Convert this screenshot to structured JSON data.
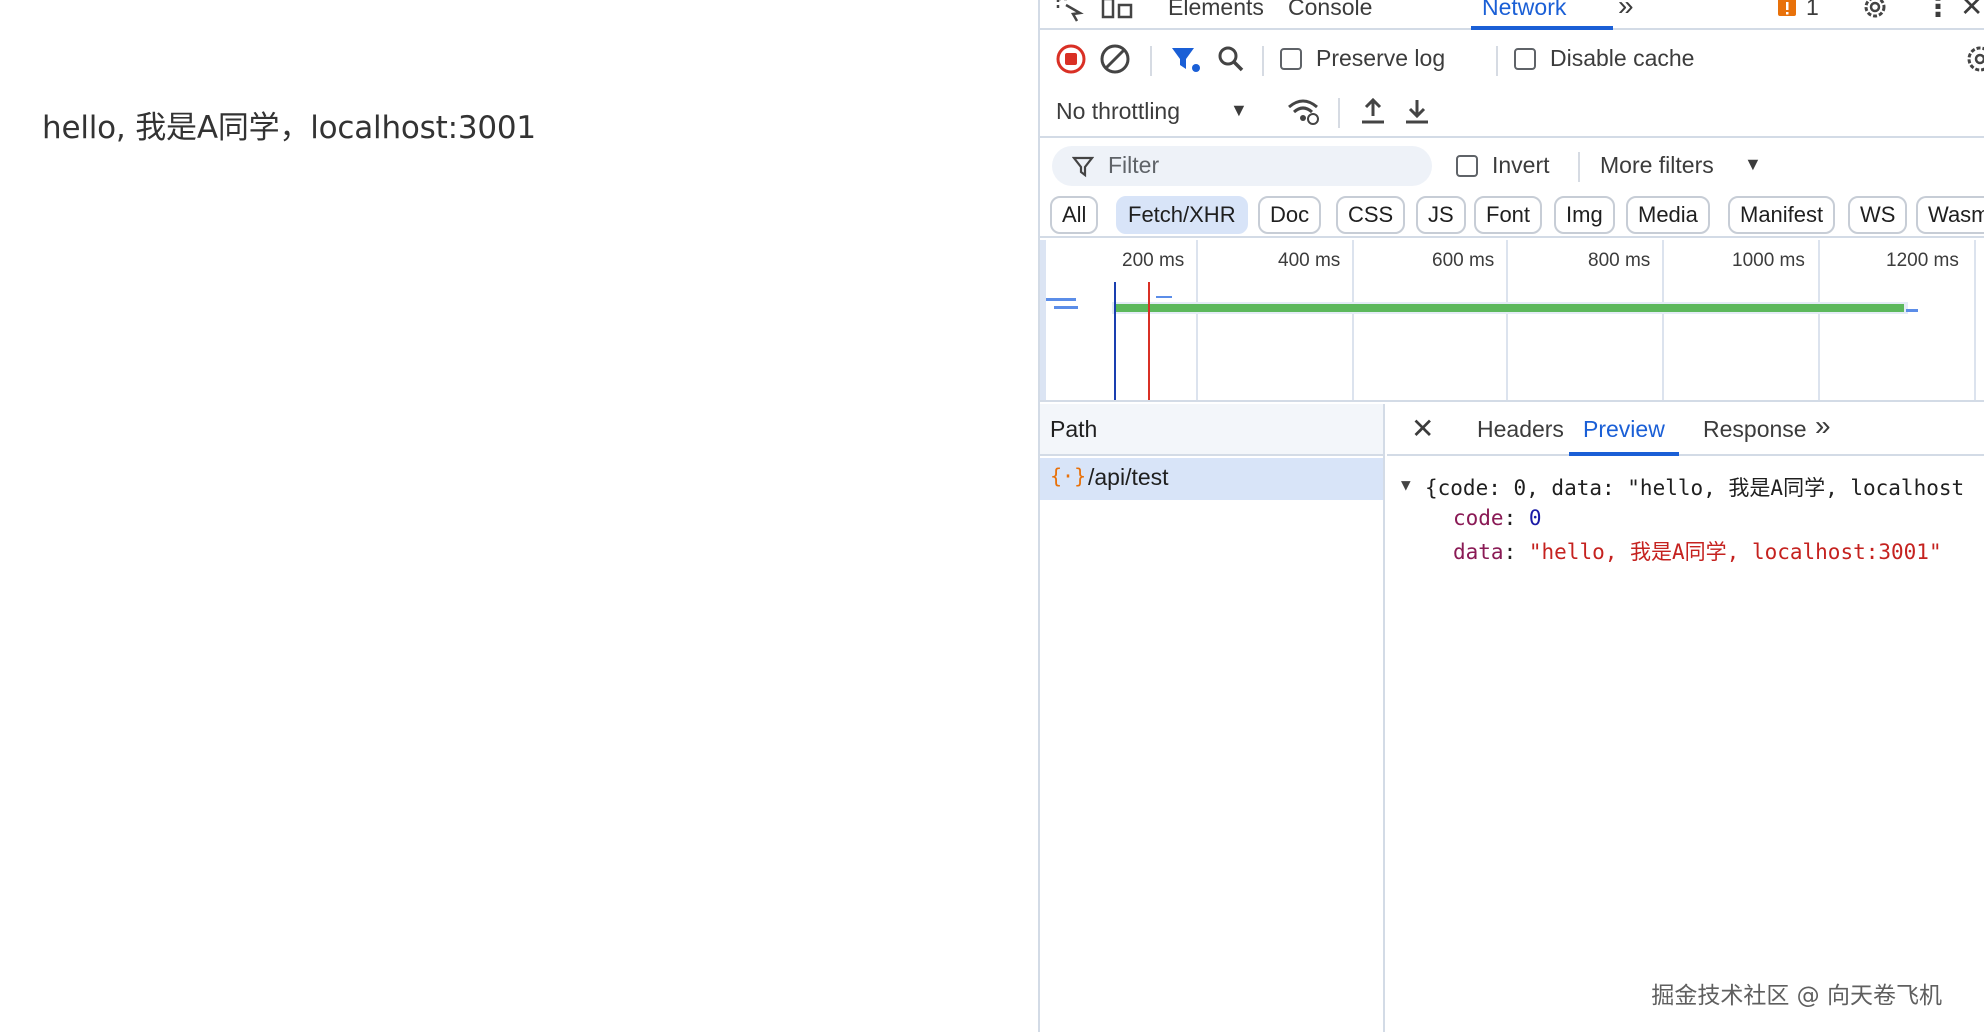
{
  "page": {
    "text": "hello, 我是A同学，localhost:3001"
  },
  "devtools": {
    "main_tabs": [
      "Elements",
      "Console",
      "Network"
    ],
    "warning_count": "1",
    "preserve_log": "Preserve log",
    "disable_cache": "Disable cache",
    "throttling": "No throttling",
    "filter_placeholder": "Filter",
    "invert": "Invert",
    "more_filters": "More filters",
    "chips": [
      "All",
      "Fetch/XHR",
      "Doc",
      "CSS",
      "JS",
      "Font",
      "Img",
      "Media",
      "Manifest",
      "WS",
      "Wasm"
    ],
    "active_chip": "Fetch/XHR",
    "timeline_ticks": [
      "200 ms",
      "400 ms",
      "600 ms",
      "800 ms",
      "1000 ms",
      "1200 ms"
    ],
    "requests": {
      "header": "Path",
      "rows": [
        "/api/test"
      ]
    },
    "detail_tabs": [
      "Headers",
      "Preview",
      "Response"
    ],
    "active_detail_tab": "Preview",
    "preview": {
      "summary": "{code: 0, data: \"hello, 我是A同学, localhost",
      "code_key": "code",
      "code_value": "0",
      "data_key": "data",
      "data_value": "\"hello, 我是A同学, localhost:3001\""
    },
    "colors": {
      "accent": "#1a5fd6",
      "record": "#d93025",
      "green_bar": "#5cb85c"
    }
  },
  "watermark": "掘金技术社区 @ 向天卷飞机"
}
